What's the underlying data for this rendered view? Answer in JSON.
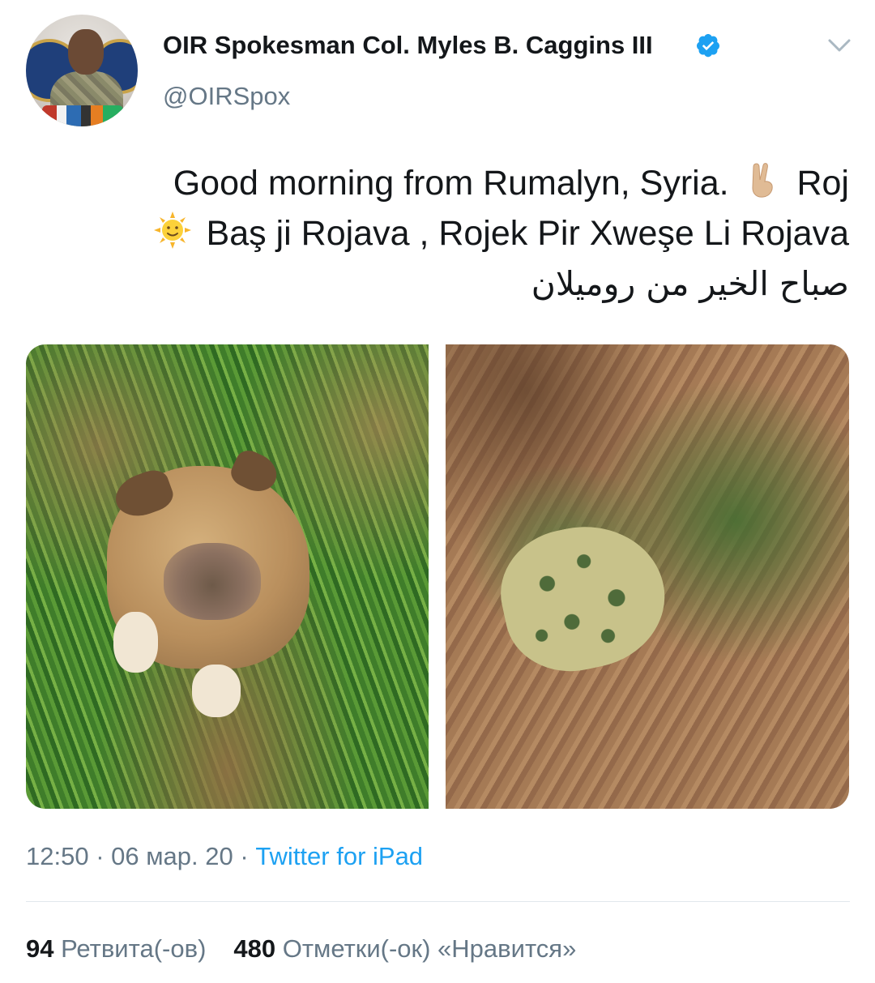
{
  "author": {
    "display_name": "OIR Spokesman Col. Myles B. Caggins III",
    "handle": "@OIRSpox",
    "verified": true,
    "verified_color": "#1da1f2",
    "avatar": "avatar-photo"
  },
  "menu": {
    "icon": "chevron-down-icon"
  },
  "tweet": {
    "line1_text": "Good morning from Rumalyn, Syria.",
    "line1_emoji": "victory-hand-emoji",
    "line1_tail": "Roj",
    "line2_emoji": "sun-with-face-emoji",
    "line2_text": "Baş ji Rojava , Rojek Pir Xweşe Li Rojava",
    "line3_text": "صباح الخير من روميلان"
  },
  "media": [
    {
      "name": "photo-puppy",
      "description": "puppy-in-grass"
    },
    {
      "name": "photo-toad",
      "description": "toad-on-soil"
    }
  ],
  "meta": {
    "time": "12:50",
    "separator": " · ",
    "date": "06 мар. 20",
    "source": "Twitter for iPad"
  },
  "stats": {
    "retweets_count": "94",
    "retweets_label": "Ретвита(-ов)",
    "likes_count": "480",
    "likes_label": "Отметки(-ок) «Нравится»"
  },
  "colors": {
    "text_primary": "#14171a",
    "text_secondary": "#657786",
    "link": "#1da1f2",
    "divider": "#e1e8ed"
  }
}
